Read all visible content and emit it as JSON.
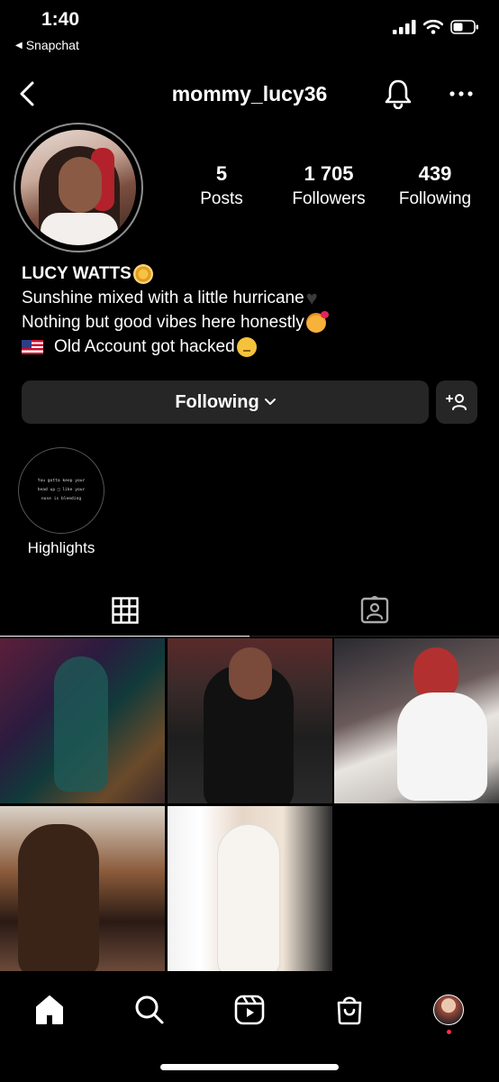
{
  "status_bar": {
    "time": "1:40",
    "back_app": "Snapchat",
    "icons": [
      "signal-icon",
      "wifi-icon",
      "battery-icon"
    ]
  },
  "header": {
    "username": "mommy_lucy36",
    "icons": [
      "back-arrow-icon",
      "bell-icon",
      "more-icon"
    ]
  },
  "profile": {
    "stats": {
      "posts_count": "5",
      "posts_label": "Posts",
      "followers_count": "1 705",
      "followers_label": "Followers",
      "following_count": "439",
      "following_label": "Following"
    },
    "bio": {
      "name": "LUCY WATTS",
      "line1": "Sunshine mixed with a little hurricane",
      "line2": "Nothing but good vibes here honestly",
      "line3": "Old Account got hacked"
    }
  },
  "actions": {
    "following_label": "Following",
    "suggest_icon": "add-person-icon"
  },
  "highlights": [
    {
      "label": "Highlights",
      "cover_text_1": "You gotta keep your",
      "cover_text_2": "head up □ like your",
      "cover_text_3": "nose is bleeding"
    }
  ],
  "tabs": [
    {
      "name": "posts-grid",
      "icon": "grid-icon",
      "active": true
    },
    {
      "name": "tagged",
      "icon": "tagged-icon",
      "active": false
    }
  ],
  "posts_count_shown": 5,
  "bottom_nav": [
    "home-icon",
    "search-icon",
    "reels-icon",
    "shop-icon",
    "profile-avatar"
  ],
  "colors": {
    "background": "#000000",
    "button_bg": "#262626",
    "text": "#ffffff",
    "notification_dot": "#ff3040"
  }
}
